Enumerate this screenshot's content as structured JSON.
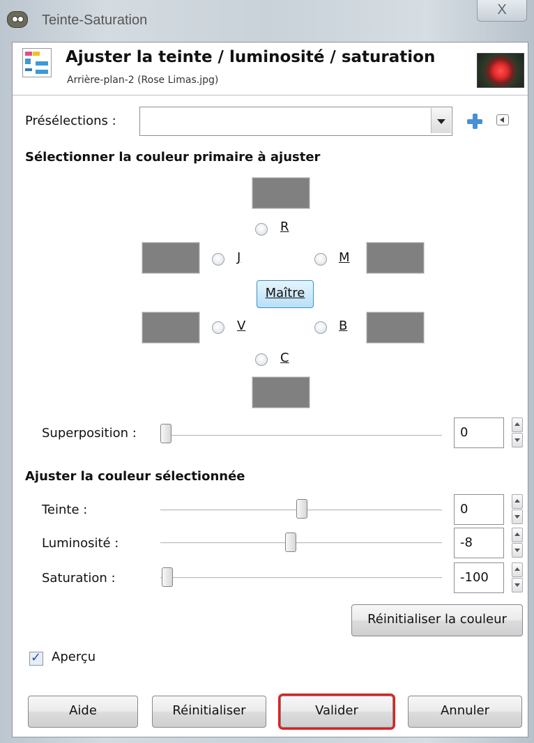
{
  "window": {
    "title": "Teinte-Saturation",
    "close_label": "X"
  },
  "header": {
    "title": "Ajuster la teinte / luminosité / saturation",
    "subtitle": "Arrière-plan-2 (Rose Limas.jpg)"
  },
  "presets": {
    "label": "Présélections :",
    "value": ""
  },
  "primary_color": {
    "heading": "Sélectionner la couleur primaire à ajuster",
    "radios": {
      "r": "R",
      "j": "J",
      "m": "M",
      "v": "V",
      "b": "B",
      "c": "C"
    },
    "master_label": "Maître"
  },
  "overlap": {
    "label": "Superposition :",
    "value": "0",
    "slider_fraction": 0.0
  },
  "adjust": {
    "heading": "Ajuster la couleur sélectionnée",
    "hue": {
      "label": "Teinte :",
      "value": "0",
      "slider_fraction": 0.5
    },
    "lightness": {
      "label": "Luminosité :",
      "value": "-8",
      "slider_fraction": 0.46
    },
    "saturation": {
      "label": "Saturation :",
      "value": "-100",
      "slider_fraction": 0.0
    },
    "reset_color_label": "Réinitialiser la couleur"
  },
  "preview": {
    "label": "Aperçu",
    "checked": true
  },
  "buttons": {
    "help": "Aide",
    "reset": "Réinitialiser",
    "ok": "Valider",
    "cancel": "Annuler"
  },
  "colors": {
    "swatch": "#808080",
    "highlight": "#e02020"
  }
}
